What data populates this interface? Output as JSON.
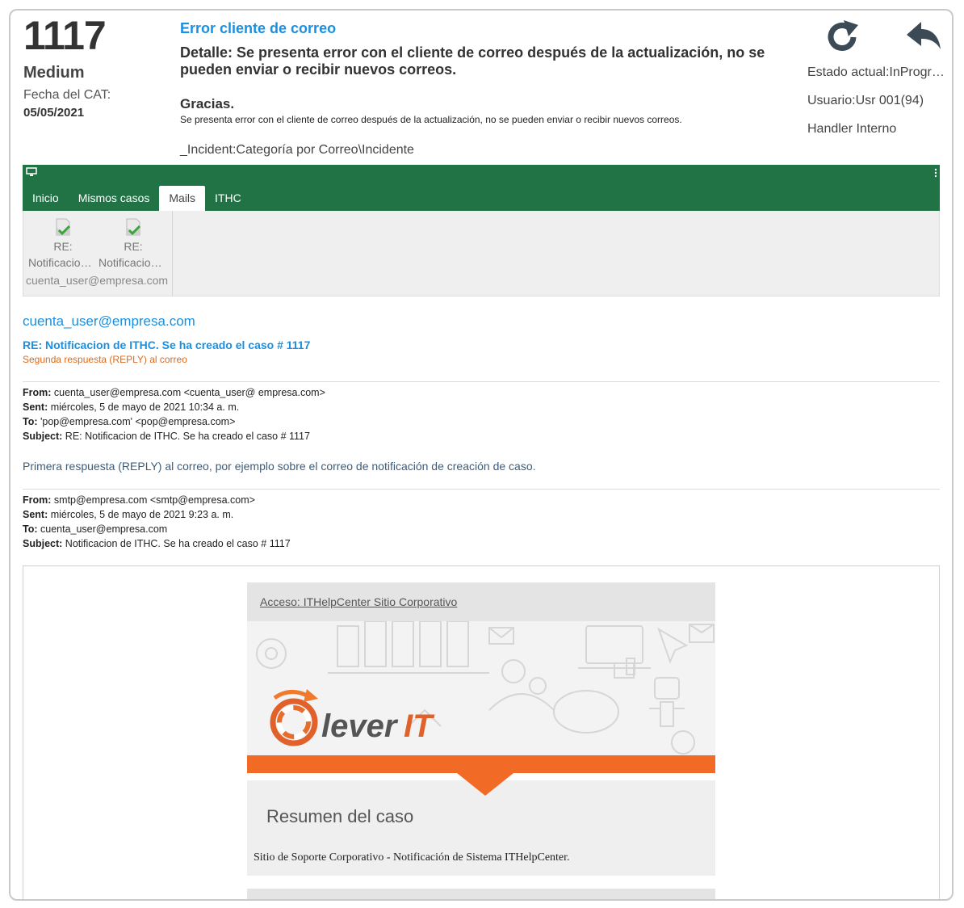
{
  "case": {
    "number": "1117",
    "priority": "Medium",
    "cat_label": "Fecha del CAT:",
    "cat_date": "05/05/2021",
    "title": "Error cliente de correo",
    "detail": "Detalle: Se presenta error con el cliente de correo después de la actualización, no se pueden enviar o recibir nuevos correos.",
    "thanks": "Gracias.",
    "detail_small": "Se presenta error con el cliente de correo después de la actualización, no se pueden enviar o recibir nuevos correos.",
    "category": "_Incident:Categoría por Correo\\Incidente",
    "status": "Estado actual:InProgress",
    "user": "Usuario:Usr 001(94)",
    "handler": "Handler Interno"
  },
  "icons": {
    "refresh": "refresh-icon",
    "reply": "reply-icon",
    "monitor": "monitor-icon",
    "more": "kebab-menu-icon",
    "mail": "mail-read-icon"
  },
  "colors": {
    "tabbar": "#217346",
    "link": "#1b8fe0",
    "accent_orange": "#f26b26",
    "reply_note": "#e06a1b"
  },
  "tabs": [
    {
      "label": "Inicio"
    },
    {
      "label": "Mismos casos"
    },
    {
      "label": "Mails",
      "active": true
    },
    {
      "label": "ITHC"
    }
  ],
  "mails": {
    "items": [
      {
        "line1": "RE:",
        "line2": "Notificacion de ITHC"
      },
      {
        "line1": "RE:",
        "line2": "Notificacion de ITHC"
      }
    ],
    "account": "cuenta_user@empresa.com"
  },
  "email": {
    "sender": "cuenta_user@empresa.com",
    "subject": "RE: Notificacion de ITHC. Se ha creado el caso # 1117",
    "reply_note": "Segunda respuesta (REPLY) al correo",
    "header1": {
      "from_label": "From:",
      "from": "cuenta_user@empresa.com   <cuenta_user@ empresa.com>",
      "sent_label": "Sent:",
      "sent": "miércoles, 5 de mayo de 2021 10:34 a. m.",
      "to_label": "To:",
      "to": "'pop@empresa.com'  <pop@empresa.com>",
      "subject_label": "Subject:",
      "subject": "RE: Notificacion de ITHC. Se ha creado el caso # 1117"
    },
    "first_reply": "Primera respuesta (REPLY) al correo, por ejemplo sobre el correo de notificación de creación de caso.",
    "header2": {
      "from_label": "From:",
      "from": "smtp@empresa.com  <smtp@empresa.com>",
      "sent_label": "Sent:",
      "sent": "miércoles, 5 de mayo de 2021 9:23 a. m.",
      "to_label": "To:",
      "to": "cuenta_user@empresa.com",
      "subject_label": "Subject:",
      "subject": "Notificacion de ITHC. Se ha creado el caso # 1117"
    },
    "embed": {
      "access_link": "Acceso: ITHelpCenter Sitio Corporativo",
      "logo_text_1": "lever",
      "logo_text_2": "IT",
      "summary_title": "Resumen del caso",
      "summary_text": "Sitio de Soporte Corporativo - Notificación de Sistema ITHelpCenter."
    }
  }
}
